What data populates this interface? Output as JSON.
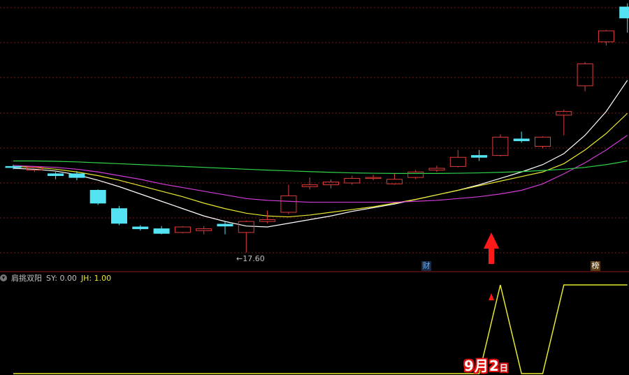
{
  "colors": {
    "background": "#000000",
    "grid": "#7a1a1a",
    "up": "#e23b3b",
    "down": "#53e3f2",
    "ma_white": "#ffffff",
    "ma_yellow": "#e8e830",
    "ma_magenta": "#d23bd8",
    "ma_green": "#2fd34a",
    "indicator": "#e8e830",
    "arrow": "#ff1a1a"
  },
  "price_chart": {
    "low_marker_label": "←17.60",
    "badges": [
      {
        "text": "财",
        "color": "#5ab0ff",
        "bg": "#1a2a44"
      },
      {
        "text": "榜",
        "color": "#ffffff",
        "bg": "#5a3a10"
      }
    ]
  },
  "indicator_panel": {
    "name": "肩挑双阳",
    "sy_label": "SY: 0.00",
    "jh_label": "JH: 1.00",
    "date_day_month": "9月2",
    "date_suffix": "日"
  },
  "chart_data": {
    "type": "candlestick",
    "price_range": [
      16.6,
      31.0
    ],
    "candles": [
      {
        "o": 22.3,
        "h": 22.4,
        "l": 22.15,
        "c": 22.25,
        "dir": "down"
      },
      {
        "o": 22.1,
        "h": 22.3,
        "l": 22.0,
        "c": 22.25,
        "dir": "up"
      },
      {
        "o": 21.9,
        "h": 22.0,
        "l": 21.6,
        "c": 21.8,
        "dir": "down"
      },
      {
        "o": 21.9,
        "h": 22.05,
        "l": 21.55,
        "c": 21.7,
        "dir": "down"
      },
      {
        "o": 21.0,
        "h": 21.05,
        "l": 20.2,
        "c": 20.3,
        "dir": "down"
      },
      {
        "o": 20.0,
        "h": 20.15,
        "l": 19.1,
        "c": 19.2,
        "dir": "down"
      },
      {
        "o": 19.0,
        "h": 19.1,
        "l": 18.8,
        "c": 18.9,
        "dir": "down"
      },
      {
        "o": 18.9,
        "h": 19.05,
        "l": 18.6,
        "c": 18.65,
        "dir": "down"
      },
      {
        "o": 18.7,
        "h": 19.05,
        "l": 18.65,
        "c": 19.0,
        "dir": "up"
      },
      {
        "o": 18.9,
        "h": 19.05,
        "l": 18.6,
        "c": 18.8,
        "dir": "up"
      },
      {
        "o": 19.05,
        "h": 19.3,
        "l": 18.6,
        "c": 19.15,
        "dir": "down"
      },
      {
        "o": 18.7,
        "h": 19.35,
        "l": 17.6,
        "c": 19.3,
        "dir": "up"
      },
      {
        "o": 19.3,
        "h": 19.9,
        "l": 19.2,
        "c": 19.4,
        "dir": "up"
      },
      {
        "o": 19.8,
        "h": 21.3,
        "l": 19.7,
        "c": 20.7,
        "dir": "up"
      },
      {
        "o": 21.2,
        "h": 21.7,
        "l": 21.05,
        "c": 21.3,
        "dir": "up"
      },
      {
        "o": 21.3,
        "h": 21.6,
        "l": 21.1,
        "c": 21.45,
        "dir": "up"
      },
      {
        "o": 21.4,
        "h": 21.8,
        "l": 21.3,
        "c": 21.65,
        "dir": "up"
      },
      {
        "o": 21.65,
        "h": 21.85,
        "l": 21.55,
        "c": 21.7,
        "dir": "up"
      },
      {
        "o": 21.35,
        "h": 21.9,
        "l": 21.3,
        "c": 21.6,
        "dir": "up"
      },
      {
        "o": 21.7,
        "h": 22.1,
        "l": 21.6,
        "c": 22.0,
        "dir": "up"
      },
      {
        "o": 22.1,
        "h": 22.35,
        "l": 22.0,
        "c": 22.2,
        "dir": "up"
      },
      {
        "o": 22.3,
        "h": 23.2,
        "l": 22.25,
        "c": 22.8,
        "dir": "up"
      },
      {
        "o": 22.9,
        "h": 23.2,
        "l": 22.6,
        "c": 22.8,
        "dir": "down"
      },
      {
        "o": 22.9,
        "h": 24.05,
        "l": 22.85,
        "c": 23.9,
        "dir": "up"
      },
      {
        "o": 23.7,
        "h": 24.2,
        "l": 23.6,
        "c": 23.8,
        "dir": "down"
      },
      {
        "o": 23.4,
        "h": 23.95,
        "l": 23.3,
        "c": 23.9,
        "dir": "up"
      },
      {
        "o": 25.1,
        "h": 25.4,
        "l": 24.0,
        "c": 25.3,
        "dir": "up"
      },
      {
        "o": 26.7,
        "h": 28.0,
        "l": 26.4,
        "c": 27.9,
        "dir": "up"
      },
      {
        "o": 29.1,
        "h": 29.75,
        "l": 28.9,
        "c": 29.7,
        "dir": "up"
      },
      {
        "o": 31.0,
        "h": 31.2,
        "l": 29.6,
        "c": 30.4,
        "dir": "down"
      }
    ],
    "series": [
      {
        "color": "ma_white",
        "values": [
          22.2,
          22.15,
          22.05,
          21.85,
          21.55,
          21.2,
          20.8,
          20.4,
          20.0,
          19.6,
          19.3,
          19.05,
          19.0,
          19.2,
          19.4,
          19.6,
          19.85,
          20.05,
          20.25,
          20.5,
          20.75,
          21.0,
          21.3,
          21.65,
          22.0,
          22.4,
          23.0,
          24.0,
          25.3,
          27.0
        ]
      },
      {
        "color": "ma_yellow",
        "values": [
          22.3,
          22.25,
          22.15,
          22.0,
          21.8,
          21.55,
          21.25,
          20.95,
          20.65,
          20.3,
          20.0,
          19.75,
          19.6,
          19.55,
          19.65,
          19.8,
          19.95,
          20.1,
          20.3,
          20.5,
          20.75,
          21.0,
          21.25,
          21.5,
          21.75,
          22.0,
          22.45,
          23.2,
          24.1,
          25.2
        ]
      },
      {
        "color": "ma_magenta",
        "values": [
          22.35,
          22.3,
          22.25,
          22.15,
          22.0,
          21.8,
          21.6,
          21.35,
          21.15,
          20.95,
          20.75,
          20.55,
          20.45,
          20.4,
          20.35,
          20.35,
          20.35,
          20.35,
          20.35,
          20.4,
          20.45,
          20.55,
          20.65,
          20.8,
          21.0,
          21.35,
          21.9,
          22.5,
          23.2,
          24.0
        ]
      },
      {
        "color": "ma_green",
        "values": [
          22.6,
          22.6,
          22.58,
          22.55,
          22.5,
          22.45,
          22.4,
          22.35,
          22.3,
          22.25,
          22.2,
          22.15,
          22.1,
          22.06,
          22.02,
          21.98,
          21.95,
          21.93,
          21.92,
          21.92,
          21.92,
          21.93,
          21.95,
          21.98,
          22.02,
          22.08,
          22.15,
          22.25,
          22.4,
          22.6
        ]
      }
    ],
    "indicator": {
      "range": [
        0,
        1
      ],
      "values": [
        0,
        0,
        0,
        0,
        0,
        0,
        0,
        0,
        0,
        0,
        0,
        0,
        0,
        0,
        0,
        0,
        0,
        0,
        0,
        0,
        0,
        0,
        0,
        1,
        0,
        0,
        1,
        1,
        1,
        1
      ]
    }
  }
}
